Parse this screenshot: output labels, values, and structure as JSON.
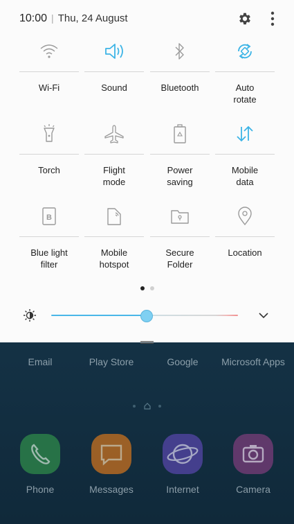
{
  "status_bar": {
    "time": "10:00",
    "separator": "|",
    "date": "Thu, 24 August"
  },
  "icons": {
    "settings": "gear-icon",
    "more": "more-vert-icon",
    "brightness": "brightness-icon",
    "expand": "chevron-down-icon"
  },
  "tiles": [
    {
      "label": "Wi-Fi",
      "icon": "wifi-icon",
      "active": false
    },
    {
      "label": "Sound",
      "icon": "volume-icon",
      "active": true
    },
    {
      "label": "Bluetooth",
      "icon": "bluetooth-icon",
      "active": false
    },
    {
      "label": "Auto\nrotate",
      "icon": "auto-rotate-icon",
      "active": true
    },
    {
      "label": "Torch",
      "icon": "torch-icon",
      "active": false
    },
    {
      "label": "Flight\nmode",
      "icon": "airplane-icon",
      "active": false
    },
    {
      "label": "Power\nsaving",
      "icon": "battery-recycle-icon",
      "active": false
    },
    {
      "label": "Mobile\ndata",
      "icon": "data-arrows-icon",
      "active": true
    },
    {
      "label": "Blue light\nfilter",
      "icon": "blue-light-icon",
      "active": false
    },
    {
      "label": "Mobile\nhotspot",
      "icon": "hotspot-icon",
      "active": false
    },
    {
      "label": "Secure\nFolder",
      "icon": "secure-folder-icon",
      "active": false
    },
    {
      "label": "Location",
      "icon": "location-pin-icon",
      "active": false
    }
  ],
  "pagination": {
    "pages": 2,
    "current": 1
  },
  "brightness": {
    "level": 0.48
  },
  "colors": {
    "accent": "#3cb4e6",
    "inactive_icon": "#8a8a8a",
    "panel_bg": "#fbfbfb"
  },
  "home": {
    "top_row": [
      "Email",
      "Play Store",
      "Google",
      "Microsoft Apps"
    ],
    "dock": [
      {
        "label": "Phone",
        "icon": "phone-icon",
        "color": "#2f8a4a"
      },
      {
        "label": "Messages",
        "icon": "messages-icon",
        "color": "#c9711f"
      },
      {
        "label": "Internet",
        "icon": "internet-icon",
        "color": "#5546a8"
      },
      {
        "label": "Camera",
        "icon": "camera-icon",
        "color": "#7a3d7a"
      }
    ]
  }
}
